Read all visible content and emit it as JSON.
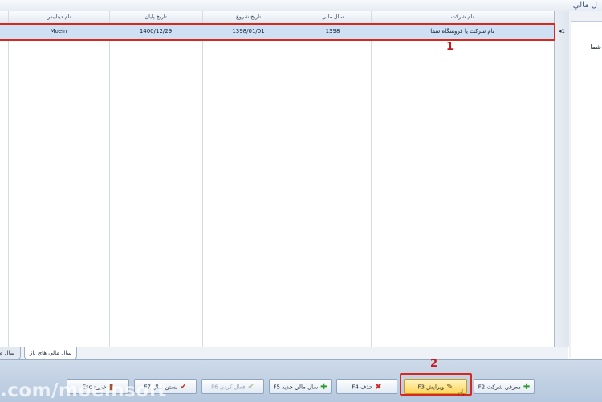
{
  "window": {
    "title": "ل مالي"
  },
  "grid": {
    "columns": [
      "نام شرکت",
      "سال مالي",
      "تاريخ شروع",
      "تاريخ پايان",
      "نام ديتابيس"
    ],
    "rows": [
      {
        "indicator": "1",
        "company": "نام شرکت يا فروشگاه شما",
        "year": "1398",
        "start": "1398/01/01",
        "end": "1400/12/29",
        "db": "Moein"
      }
    ]
  },
  "annotations": {
    "badge1": "1",
    "badge2": "2"
  },
  "right_panel": {
    "text": "شما"
  },
  "tabs": [
    "سال مالي هاي باز",
    "سال م"
  ],
  "buttons": {
    "define_company": "معرفي شرکت F2",
    "edit": "ويرايش F3",
    "delete": "حذف F4",
    "new_year": "سال مالي جديد F5",
    "activate": "فعال کردن F6",
    "close_year": "بستن سال F7",
    "exit": "خروج Esc"
  },
  "watermark": ".com/moeinsoft",
  "colors": {
    "accent_red": "#d7281e",
    "selection": "#cfe0f4",
    "hot_button": "#ffd45a"
  }
}
